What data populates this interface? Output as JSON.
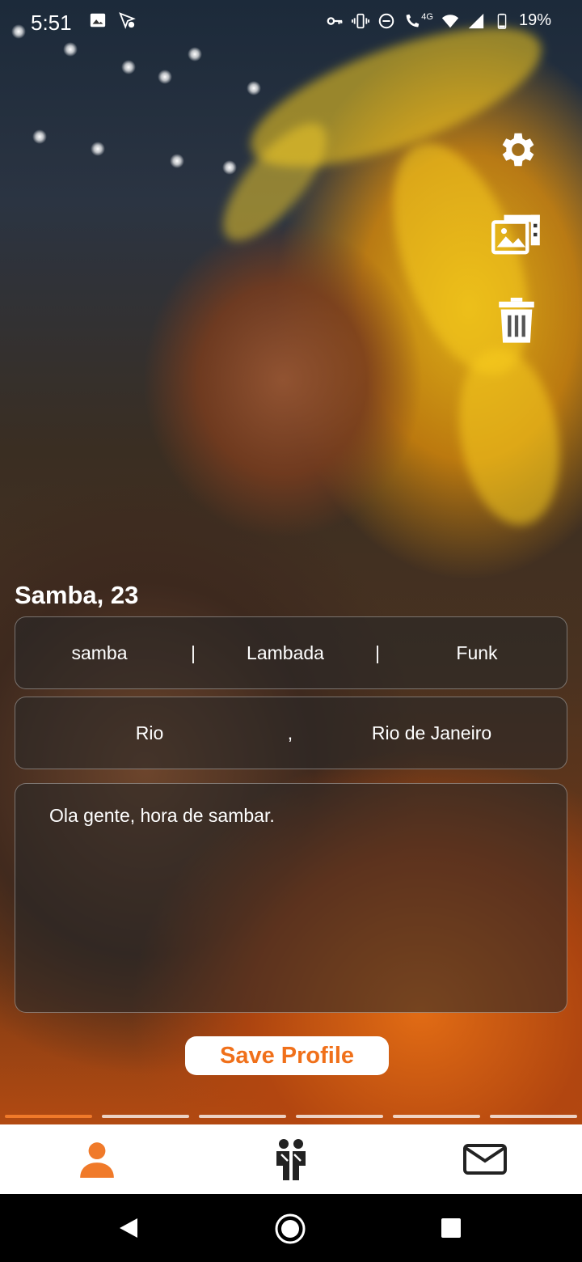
{
  "status_bar": {
    "time": "5:51",
    "battery": "19%",
    "network": "4G"
  },
  "profile": {
    "title": "Samba, 23",
    "styles": [
      "samba",
      "Lambada",
      "Funk"
    ],
    "style_separator": "|",
    "location": {
      "city": "Rio",
      "separator": ",",
      "state": "Rio de Janeiro"
    },
    "about": "Ola gente, hora de sambar."
  },
  "actions": {
    "save_label": "Save Profile"
  },
  "pager": {
    "total": 6,
    "active_index": 0
  },
  "colors": {
    "accent": "#f07a2a",
    "nav_active": "#f07a2a",
    "nav_inactive": "#222222"
  },
  "icons": {
    "settings": "gear-icon",
    "gallery": "image-gallery-icon",
    "delete": "trash-icon",
    "nav_profile": "person-icon",
    "nav_matches": "people-icon",
    "nav_messages": "mail-icon"
  }
}
